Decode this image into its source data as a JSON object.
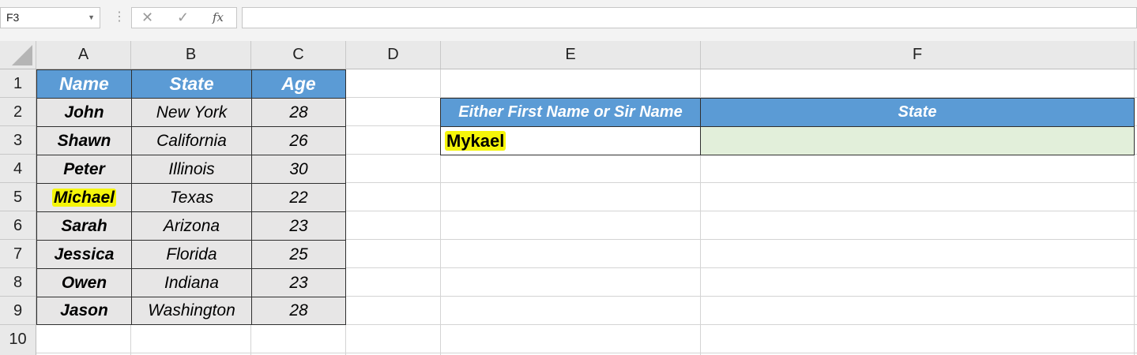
{
  "name_box": {
    "value": "F3"
  },
  "formula_bar": {
    "cancel_glyph": "✕",
    "enter_glyph": "✓",
    "fx_label": "fx",
    "value": ""
  },
  "columns": [
    "A",
    "B",
    "C",
    "D",
    "E",
    "F"
  ],
  "rows": [
    "1",
    "2",
    "3",
    "4",
    "5",
    "6",
    "7",
    "8",
    "9",
    "10"
  ],
  "table": {
    "headers": [
      "Name",
      "State",
      "Age"
    ],
    "rows": [
      [
        "John",
        "New York",
        "28"
      ],
      [
        "Shawn",
        "California",
        "26"
      ],
      [
        "Peter",
        "Illinois",
        "30"
      ],
      [
        "Michael",
        "Texas",
        "22"
      ],
      [
        "Sarah",
        "Arizona",
        "23"
      ],
      [
        "Jessica",
        "Florida",
        "25"
      ],
      [
        "Owen",
        "Indiana",
        "23"
      ],
      [
        "Jason",
        "Washington",
        "28"
      ]
    ]
  },
  "lookup": {
    "header_name": "Either First Name or Sir Name",
    "header_state": "State",
    "input_value": "Mykael",
    "result_value": ""
  },
  "colors": {
    "header_fill": "#5b9bd5",
    "data_fill": "#e7e6e6",
    "result_fill": "#e2efda",
    "highlight": "#f5f50a"
  },
  "highlighted_cells": [
    "A5",
    "E3"
  ]
}
